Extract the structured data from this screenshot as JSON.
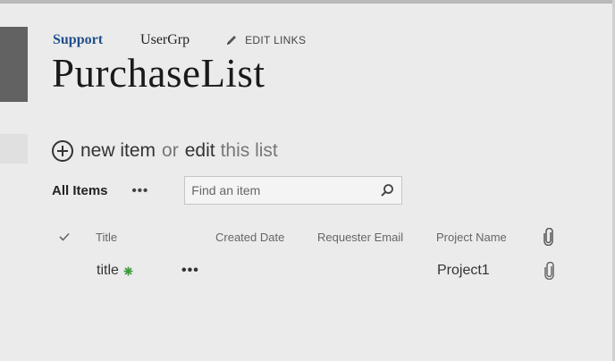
{
  "breadcrumbs": [
    {
      "label": "Support",
      "active": true
    },
    {
      "label": "UserGrp",
      "active": false
    }
  ],
  "edit_links_label": "EDIT LINKS",
  "page_title": "PurchaseList",
  "new_item": {
    "new_item_label": "new item",
    "or_label": "or",
    "edit_label": "edit",
    "this_list_label": "this list"
  },
  "view": {
    "current_view": "All Items",
    "more_label": "•••"
  },
  "search": {
    "placeholder": "Find an item"
  },
  "columns": {
    "title": "Title",
    "created_date": "Created Date",
    "requester_email": "Requester Email",
    "project_name": "Project Name"
  },
  "rows": [
    {
      "title": "title",
      "more_label": "•••",
      "created_date": "",
      "requester_email": "",
      "project_name": "Project1",
      "has_attachment": true,
      "is_new": true
    }
  ],
  "icons": {
    "edit": "pencil-icon",
    "add": "plus-circle-icon",
    "search": "search-icon",
    "select_all": "checkmark-icon",
    "attachment": "paperclip-icon",
    "new_item": "new-item-badge-icon"
  },
  "colors": {
    "background": "#ebebeb",
    "active_crumb": "#1f4e8c",
    "left_tile": "#626262",
    "new_badge": "#3a9a3a"
  }
}
